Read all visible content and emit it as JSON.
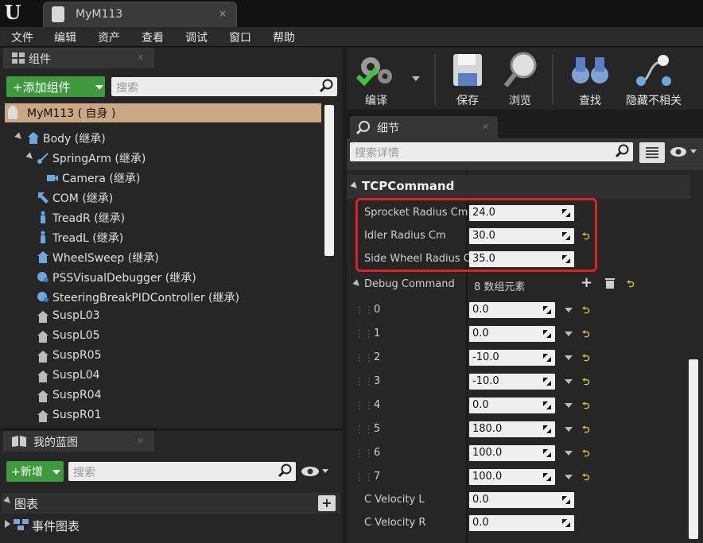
{
  "window": {
    "tab_title": "MyM113",
    "tab_close": "×"
  },
  "menu": [
    "文件",
    "编辑",
    "资产",
    "查看",
    "调试",
    "窗口",
    "帮助"
  ],
  "components": {
    "title": "组件",
    "add_button": "+添加组件",
    "search_placeholder": "搜索",
    "root": "MyM113 ( 自身 )",
    "items": [
      {
        "label": "Body (继承)",
        "icon": "actor-icon"
      },
      {
        "label": "SpringArm (继承)",
        "icon": "spring-arm-icon"
      },
      {
        "label": "Camera (继承)",
        "icon": "camera-icon"
      },
      {
        "label": "COM (继承)",
        "icon": "arrow-icon"
      },
      {
        "label": "TreadR (继承)",
        "icon": "skeletal-icon"
      },
      {
        "label": "TreadL (继承)",
        "icon": "skeletal-icon"
      },
      {
        "label": "WheelSweep (继承)",
        "icon": "actor-icon"
      },
      {
        "label": "PSSVisualDebugger (继承)",
        "icon": "component-icon"
      },
      {
        "label": "SteeringBreakPIDController (继承)",
        "icon": "component-icon"
      },
      {
        "label": "SuspL03",
        "icon": "scene-icon"
      },
      {
        "label": "SuspL05",
        "icon": "scene-icon"
      },
      {
        "label": "SuspR05",
        "icon": "scene-icon"
      },
      {
        "label": "SuspL04",
        "icon": "scene-icon"
      },
      {
        "label": "SuspR04",
        "icon": "scene-icon"
      },
      {
        "label": "SuspR01",
        "icon": "scene-icon"
      }
    ]
  },
  "blueprint": {
    "title": "我的蓝图",
    "add_button": "+新增",
    "search_placeholder": "搜索",
    "sections": [
      "图表",
      "事件图表"
    ]
  },
  "toolbar": {
    "buttons": [
      "编译",
      "保存",
      "浏览",
      "查找",
      "隐藏不相关"
    ]
  },
  "details": {
    "title": "细节",
    "search_placeholder": "搜索详情",
    "category": "TCPCommand",
    "props": [
      {
        "label": "Sprocket Radius Cm",
        "value": "24.0"
      },
      {
        "label": "Idler Radius Cm",
        "value": "30.0"
      },
      {
        "label": "Side Wheel Radius Cm",
        "value": "35.0"
      }
    ],
    "array": {
      "label": "Debug Command",
      "count": "8 数组元素",
      "items": [
        {
          "index": "0",
          "value": "0.0"
        },
        {
          "index": "1",
          "value": "0.0"
        },
        {
          "index": "2",
          "value": "-10.0"
        },
        {
          "index": "3",
          "value": "-10.0"
        },
        {
          "index": "4",
          "value": "0.0"
        },
        {
          "index": "5",
          "value": "180.0"
        },
        {
          "index": "6",
          "value": "100.0"
        },
        {
          "index": "7",
          "value": "100.0"
        }
      ]
    },
    "velocity": [
      {
        "label": "C Velocity L",
        "value": "0.0"
      },
      {
        "label": "C Velocity R",
        "value": "0.0"
      }
    ]
  },
  "colors": {
    "highlight": "#e02020",
    "accent_green": "#3d9a3d",
    "selected_row": "#c9a883"
  }
}
